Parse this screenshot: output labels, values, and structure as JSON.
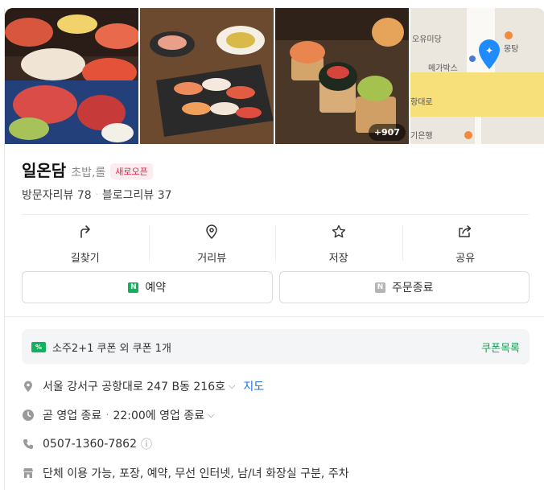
{
  "photos": {
    "more_count": "+907",
    "map_labels": [
      "오유미당",
      "몽탕",
      "메가박스",
      "항대로",
      "기은행"
    ]
  },
  "place": {
    "name": "일온담",
    "category": "초밥,롤",
    "badge": "새로오픈"
  },
  "reviews": {
    "visitor": "방문자리뷰 78",
    "separator": "·",
    "blog": "블로그리뷰 37"
  },
  "actions": [
    {
      "label": "길찾기",
      "icon": "directions-icon"
    },
    {
      "label": "거리뷰",
      "icon": "location-pin-icon"
    },
    {
      "label": "저장",
      "icon": "star-icon"
    },
    {
      "label": "공유",
      "icon": "share-icon"
    }
  ],
  "buttons": {
    "reserve": "예약",
    "order": "주문종료"
  },
  "coupon": {
    "icon_text": "%",
    "text": "소주2+1 쿠폰 외 쿠폰 1개",
    "link": "쿠폰목록"
  },
  "info": {
    "address": "서울 강서구 공항대로 247 B동 216호",
    "map_link": "지도",
    "hours": "곧 영업 종료",
    "hours_sep": "·",
    "hours_detail": "22:00에 영업 종료",
    "phone": "0507-1360-7862",
    "amenities": "단체 이용 가능, 포장, 예약, 무선 인터넷, 남/녀 화장실 구분, 주차"
  },
  "colors": {
    "accent_green": "#13a355",
    "badge_red": "#e2264b",
    "link_blue": "#1a73e8",
    "map_pin": "#1e8bff"
  }
}
